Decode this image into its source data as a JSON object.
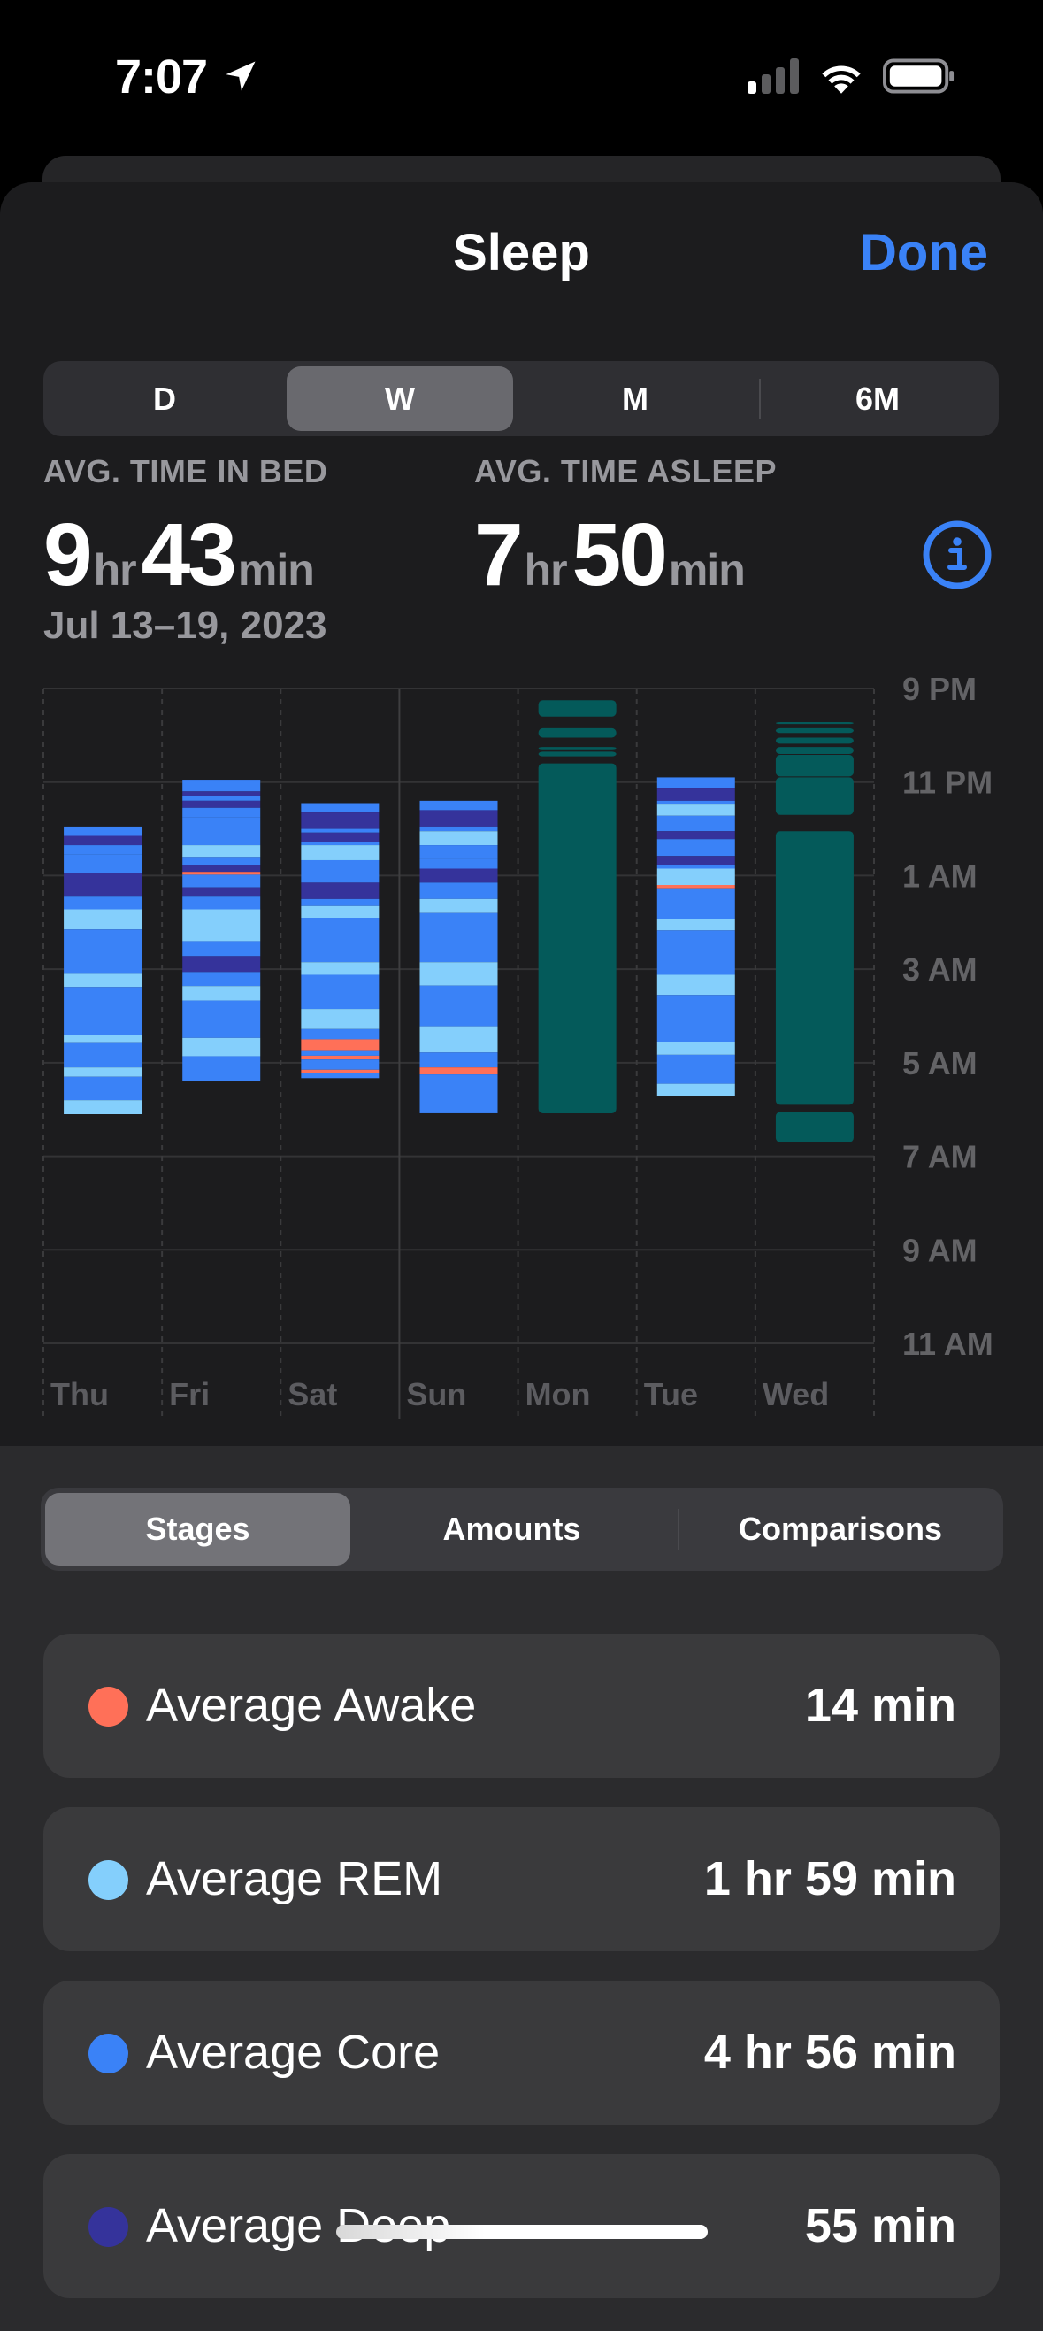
{
  "status_bar": {
    "time": "7:07",
    "icons": [
      "location-arrow-icon",
      "cellular-signal-icon",
      "wifi-icon",
      "battery-icon"
    ]
  },
  "header": {
    "title": "Sleep",
    "done_label": "Done"
  },
  "range_tabs": {
    "items": [
      "D",
      "W",
      "M",
      "6M"
    ],
    "selected": "W"
  },
  "stats": {
    "time_in_bed": {
      "label": "AVG. TIME IN BED",
      "hours": "9",
      "hours_unit": "hr",
      "minutes": "43",
      "minutes_unit": "min"
    },
    "time_asleep": {
      "label": "AVG. TIME ASLEEP",
      "hours": "7",
      "hours_unit": "hr",
      "minutes": "50",
      "minutes_unit": "min"
    },
    "date_range": "Jul 13–19, 2023",
    "info_icon": "info-circle-icon"
  },
  "colors": {
    "accent": "#3a82f7",
    "awake": "#ff7058",
    "rem": "#84cffc",
    "core": "#3a82f7",
    "deep": "#35339b",
    "in_bed": "#045a5a"
  },
  "chart_data": {
    "type": "bar",
    "subtype": "range-stacked-stages",
    "categories": [
      "Thu",
      "Fri",
      "Sat",
      "Sun",
      "Mon",
      "Tue",
      "Wed"
    ],
    "y_axis": {
      "ticks": [
        "9 PM",
        "11 PM",
        "1 AM",
        "3 AM",
        "5 AM",
        "7 AM",
        "9 AM",
        "11 AM"
      ],
      "range_hours_from_9pm": [
        0,
        14
      ],
      "position": "right"
    },
    "grid": true,
    "series": [
      {
        "day": "Thu",
        "segments": [
          [
            2.95,
            3.15,
            "core"
          ],
          [
            3.15,
            3.35,
            "deep"
          ],
          [
            3.35,
            3.55,
            "core"
          ],
          [
            3.55,
            3.95,
            "core"
          ],
          [
            3.95,
            4.45,
            "deep"
          ],
          [
            4.45,
            4.72,
            "core"
          ],
          [
            4.72,
            5.15,
            "rem"
          ],
          [
            5.15,
            6.1,
            "core"
          ],
          [
            6.1,
            6.38,
            "rem"
          ],
          [
            6.38,
            7.4,
            "core"
          ],
          [
            7.4,
            7.58,
            "rem"
          ],
          [
            7.58,
            8.1,
            "core"
          ],
          [
            8.1,
            8.3,
            "rem"
          ],
          [
            8.3,
            8.8,
            "core"
          ],
          [
            8.8,
            9.1,
            "rem"
          ]
        ]
      },
      {
        "day": "Fri",
        "segments": [
          [
            1.95,
            2.2,
            "core"
          ],
          [
            2.2,
            2.3,
            "deep"
          ],
          [
            2.3,
            2.4,
            "core"
          ],
          [
            2.4,
            2.55,
            "deep"
          ],
          [
            2.55,
            2.75,
            "core"
          ],
          [
            2.75,
            3.35,
            "core"
          ],
          [
            3.35,
            3.6,
            "rem"
          ],
          [
            3.6,
            3.78,
            "core"
          ],
          [
            3.78,
            3.92,
            "deep"
          ],
          [
            3.92,
            3.98,
            "awake"
          ],
          [
            3.98,
            4.25,
            "core"
          ],
          [
            4.25,
            4.45,
            "deep"
          ],
          [
            4.45,
            4.72,
            "core"
          ],
          [
            4.72,
            5.4,
            "rem"
          ],
          [
            5.4,
            5.72,
            "core"
          ],
          [
            5.72,
            6.06,
            "deep"
          ],
          [
            6.06,
            6.36,
            "core"
          ],
          [
            6.36,
            6.67,
            "rem"
          ],
          [
            6.67,
            7.47,
            "core"
          ],
          [
            7.47,
            7.86,
            "rem"
          ],
          [
            7.86,
            8.4,
            "core"
          ]
        ]
      },
      {
        "day": "Sat",
        "segments": [
          [
            2.45,
            2.65,
            "core"
          ],
          [
            2.65,
            3.0,
            "deep"
          ],
          [
            3.0,
            3.08,
            "core"
          ],
          [
            3.08,
            3.28,
            "deep"
          ],
          [
            3.28,
            3.35,
            "core"
          ],
          [
            3.35,
            3.67,
            "rem"
          ],
          [
            3.67,
            3.95,
            "core"
          ],
          [
            3.95,
            4.15,
            "core"
          ],
          [
            4.15,
            4.5,
            "deep"
          ],
          [
            4.5,
            4.65,
            "core"
          ],
          [
            4.65,
            4.9,
            "rem"
          ],
          [
            4.9,
            5.85,
            "core"
          ],
          [
            5.85,
            6.12,
            "rem"
          ],
          [
            6.12,
            6.85,
            "core"
          ],
          [
            6.85,
            7.28,
            "rem"
          ],
          [
            7.28,
            7.5,
            "core"
          ],
          [
            7.5,
            7.75,
            "awake"
          ],
          [
            7.75,
            7.85,
            "core"
          ],
          [
            7.85,
            7.93,
            "awake"
          ],
          [
            7.93,
            8.15,
            "core"
          ],
          [
            8.15,
            8.22,
            "awake"
          ],
          [
            8.22,
            8.33,
            "core"
          ]
        ]
      },
      {
        "day": "Sun",
        "segments": [
          [
            2.4,
            2.6,
            "core"
          ],
          [
            2.6,
            2.95,
            "deep"
          ],
          [
            2.95,
            3.05,
            "core"
          ],
          [
            3.05,
            3.35,
            "rem"
          ],
          [
            3.35,
            3.65,
            "core"
          ],
          [
            3.65,
            3.85,
            "core"
          ],
          [
            3.85,
            4.15,
            "deep"
          ],
          [
            4.15,
            4.5,
            "core"
          ],
          [
            4.5,
            4.8,
            "rem"
          ],
          [
            4.8,
            5.85,
            "core"
          ],
          [
            5.85,
            6.35,
            "rem"
          ],
          [
            6.35,
            7.22,
            "core"
          ],
          [
            7.22,
            7.78,
            "rem"
          ],
          [
            7.78,
            8.1,
            "core"
          ],
          [
            8.1,
            8.25,
            "awake"
          ],
          [
            8.25,
            9.08,
            "core"
          ]
        ]
      },
      {
        "day": "Mon",
        "segments": [
          [
            0.25,
            0.6,
            "in_bed"
          ],
          [
            0.85,
            1.05,
            "in_bed"
          ],
          [
            1.25,
            1.3,
            "in_bed"
          ],
          [
            1.35,
            1.45,
            "in_bed"
          ],
          [
            1.6,
            9.08,
            "in_bed"
          ]
        ]
      },
      {
        "day": "Tue",
        "segments": [
          [
            1.9,
            2.12,
            "core"
          ],
          [
            2.12,
            2.4,
            "deep"
          ],
          [
            2.4,
            2.48,
            "core"
          ],
          [
            2.48,
            2.72,
            "rem"
          ],
          [
            2.72,
            3.05,
            "core"
          ],
          [
            3.05,
            3.22,
            "deep"
          ],
          [
            3.22,
            3.45,
            "core"
          ],
          [
            3.45,
            3.58,
            "core"
          ],
          [
            3.58,
            3.77,
            "deep"
          ],
          [
            3.77,
            3.85,
            "core"
          ],
          [
            3.85,
            4.2,
            "rem"
          ],
          [
            4.2,
            4.27,
            "awake"
          ],
          [
            4.27,
            4.92,
            "core"
          ],
          [
            4.92,
            5.17,
            "rem"
          ],
          [
            5.17,
            6.12,
            "core"
          ],
          [
            6.12,
            6.55,
            "rem"
          ],
          [
            6.55,
            7.55,
            "core"
          ],
          [
            7.55,
            7.83,
            "rem"
          ],
          [
            7.83,
            8.45,
            "core"
          ],
          [
            8.45,
            8.72,
            "rem"
          ]
        ]
      },
      {
        "day": "Wed",
        "segments": [
          [
            0.72,
            0.76,
            "in_bed"
          ],
          [
            0.85,
            0.95,
            "in_bed"
          ],
          [
            1.05,
            1.18,
            "in_bed"
          ],
          [
            1.25,
            1.4,
            "in_bed"
          ],
          [
            1.42,
            1.88,
            "in_bed"
          ],
          [
            1.9,
            2.7,
            "in_bed"
          ],
          [
            3.05,
            8.9,
            "in_bed"
          ],
          [
            9.05,
            9.7,
            "in_bed"
          ]
        ]
      }
    ]
  },
  "view_tabs": {
    "items": [
      "Stages",
      "Amounts",
      "Comparisons"
    ],
    "selected": "Stages"
  },
  "stage_list": [
    {
      "label": "Average Awake",
      "value": "14 min",
      "color_key": "awake"
    },
    {
      "label": "Average REM",
      "value": "1 hr 59 min",
      "color_key": "rem"
    },
    {
      "label": "Average Core",
      "value": "4 hr 56 min",
      "color_key": "core"
    },
    {
      "label": "Average Deep",
      "value": "55 min",
      "color_key": "deep"
    }
  ]
}
